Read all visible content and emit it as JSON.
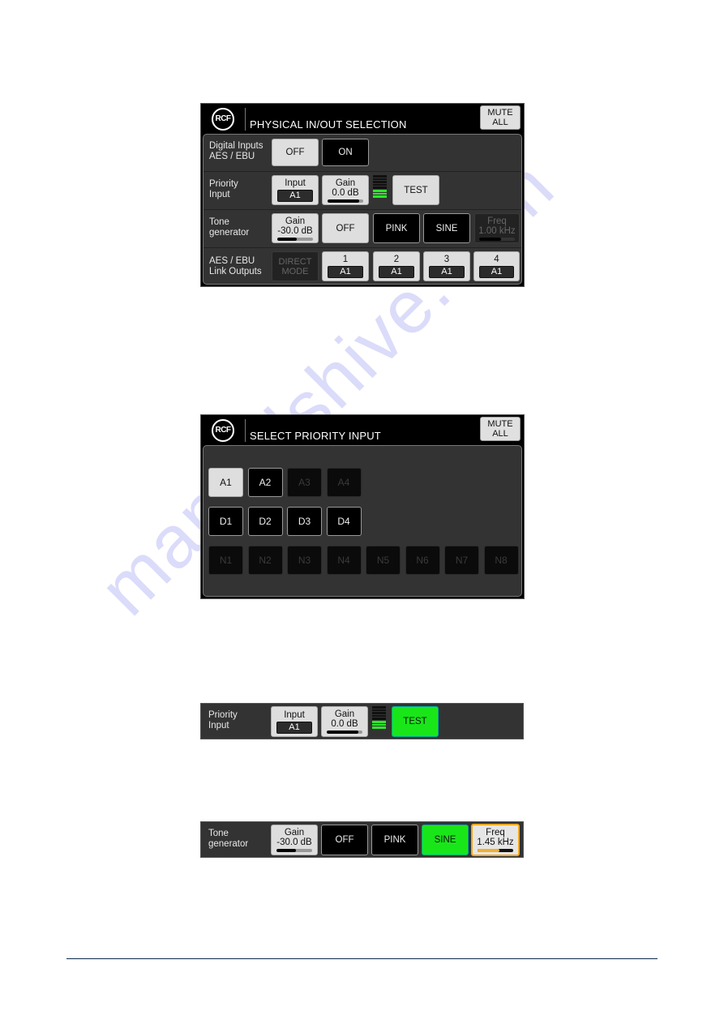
{
  "screens": {
    "physical_io": {
      "logo": "RCF",
      "title": "PHYSICAL IN/OUT SELECTION",
      "mute_all": [
        "MUTE",
        "ALL"
      ],
      "digital_inputs": {
        "label": [
          "Digital Inputs",
          "AES / EBU"
        ],
        "off_label": "OFF",
        "on_label": "ON",
        "selected": "OFF"
      },
      "priority_input": {
        "label": [
          "Priority",
          "Input"
        ],
        "input_label": "Input",
        "input_value": "A1",
        "gain_label": "Gain",
        "gain_value": "0.0 dB",
        "gain_fraction": 0.88,
        "meter_segments": 8,
        "meter_active": 3,
        "test_label": "TEST",
        "test_active": false
      },
      "tone_generator": {
        "label": [
          "Tone",
          "generator"
        ],
        "gain_label": "Gain",
        "gain_value": "-30.0 dB",
        "gain_fraction": 0.55,
        "off_label": "OFF",
        "pink_label": "PINK",
        "sine_label": "SINE",
        "selected": "OFF",
        "freq_label": "Freq",
        "freq_value": "1.00 kHz",
        "freq_fraction": 0.62,
        "freq_enabled": false
      },
      "aes_ebu_outputs": {
        "label": [
          "AES / EBU",
          "Link Outputs"
        ],
        "direct_mode": [
          "DIRECT",
          "MODE"
        ],
        "outputs": [
          {
            "num": "1",
            "value": "A1"
          },
          {
            "num": "2",
            "value": "A1"
          },
          {
            "num": "3",
            "value": "A1"
          },
          {
            "num": "4",
            "value": "A1"
          }
        ]
      }
    },
    "select_priority": {
      "logo": "RCF",
      "title": "SELECT PRIORITY INPUT",
      "mute_all": [
        "MUTE",
        "ALL"
      ],
      "analog": [
        {
          "label": "A1",
          "state": "selected"
        },
        {
          "label": "A2",
          "state": "enabled"
        },
        {
          "label": "A3",
          "state": "disabled"
        },
        {
          "label": "A4",
          "state": "disabled"
        }
      ],
      "digital": [
        {
          "label": "D1",
          "state": "enabled"
        },
        {
          "label": "D2",
          "state": "enabled"
        },
        {
          "label": "D3",
          "state": "enabled"
        },
        {
          "label": "D4",
          "state": "enabled"
        }
      ],
      "network": [
        {
          "label": "N1",
          "state": "disabled"
        },
        {
          "label": "N2",
          "state": "disabled"
        },
        {
          "label": "N3",
          "state": "disabled"
        },
        {
          "label": "N4",
          "state": "disabled"
        },
        {
          "label": "N5",
          "state": "disabled"
        },
        {
          "label": "N6",
          "state": "disabled"
        },
        {
          "label": "N7",
          "state": "disabled"
        },
        {
          "label": "N8",
          "state": "disabled"
        }
      ]
    },
    "priority_strip_test": {
      "label": [
        "Priority",
        "Input"
      ],
      "input_label": "Input",
      "input_value": "A1",
      "gain_label": "Gain",
      "gain_value": "0.0 dB",
      "gain_fraction": 0.88,
      "meter_segments": 8,
      "meter_active": 3,
      "test_label": "TEST",
      "test_active": true
    },
    "tone_strip_sine": {
      "label": [
        "Tone",
        "generator"
      ],
      "gain_label": "Gain",
      "gain_value": "-30.0 dB",
      "gain_fraction": 0.55,
      "off_label": "OFF",
      "pink_label": "PINK",
      "sine_label": "SINE",
      "selected": "SINE",
      "freq_label": "Freq",
      "freq_value": "1.45 kHz",
      "freq_fraction": 0.62,
      "freq_focused": true
    }
  },
  "colors": {
    "active_green": "#19e619",
    "focus_orange": "#f0a820",
    "meter_green": "#2ee62e",
    "panel_gray": "#333333"
  },
  "watermark": "manualshive.com"
}
